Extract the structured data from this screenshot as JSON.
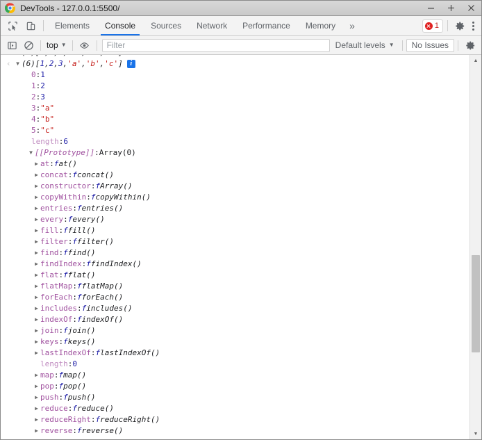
{
  "window": {
    "title": "DevTools - 127.0.0.1:5500/",
    "logo_icon": "chrome-logo",
    "controls": {
      "minimize": "−",
      "maximize": "+",
      "close": "×"
    }
  },
  "tabbar": {
    "inspect_icon": "inspect-element-icon",
    "device_icon": "device-toolbar-icon",
    "tabs": [
      {
        "label": "Elements",
        "active": false
      },
      {
        "label": "Console",
        "active": true
      },
      {
        "label": "Sources",
        "active": false
      },
      {
        "label": "Network",
        "active": false
      },
      {
        "label": "Performance",
        "active": false
      },
      {
        "label": "Memory",
        "active": false
      }
    ],
    "more_tabs": "»",
    "error_count": "1",
    "error_icon": "error-circle-icon",
    "settings_icon": "gear-icon",
    "menu_icon": "kebab-menu-icon"
  },
  "console_toolbar": {
    "sidebar_icon": "console-sidebar-icon",
    "clear_icon": "clear-console-icon",
    "context": "top",
    "context_caret": "▼",
    "eye_icon": "live-expression-icon",
    "filter_placeholder": "Filter",
    "filter_value": "",
    "levels_label": "Default levels",
    "levels_caret": "▼",
    "issues_label": "No Issues",
    "settings_icon": "gear-icon"
  },
  "console": {
    "clipped_row_note": "partially-scrolled array preview",
    "header": {
      "input_arrow": "‹",
      "triangle": "▼",
      "count": "(6)",
      "open": "[",
      "items": [
        {
          "text": "1",
          "type": "num"
        },
        {
          "text": "2",
          "type": "num"
        },
        {
          "text": "3",
          "type": "num"
        },
        {
          "text": "'a'",
          "type": "str"
        },
        {
          "text": "'b'",
          "type": "str"
        },
        {
          "text": "'c'",
          "type": "str"
        }
      ],
      "close": "]",
      "info_badge": "i"
    },
    "indexed_properties": [
      {
        "key": "0",
        "value": "1",
        "type": "num"
      },
      {
        "key": "1",
        "value": "2",
        "type": "num"
      },
      {
        "key": "2",
        "value": "3",
        "type": "num"
      },
      {
        "key": "3",
        "value": "\"a\"",
        "type": "str"
      },
      {
        "key": "4",
        "value": "\"b\"",
        "type": "str"
      },
      {
        "key": "5",
        "value": "\"c\"",
        "type": "str"
      }
    ],
    "length_row": {
      "key": "length",
      "value": "6"
    },
    "prototype_row": {
      "triangle": "▼",
      "key": "[[Prototype]]",
      "value": "Array(0)"
    },
    "prototype_members": [
      {
        "key": "at",
        "fn": "at()",
        "expandable": true
      },
      {
        "key": "concat",
        "fn": "concat()",
        "expandable": true
      },
      {
        "key": "constructor",
        "fn": "Array()",
        "expandable": true
      },
      {
        "key": "copyWithin",
        "fn": "copyWithin()",
        "expandable": true
      },
      {
        "key": "entries",
        "fn": "entries()",
        "expandable": true
      },
      {
        "key": "every",
        "fn": "every()",
        "expandable": true
      },
      {
        "key": "fill",
        "fn": "fill()",
        "expandable": true
      },
      {
        "key": "filter",
        "fn": "filter()",
        "expandable": true
      },
      {
        "key": "find",
        "fn": "find()",
        "expandable": true
      },
      {
        "key": "findIndex",
        "fn": "findIndex()",
        "expandable": true
      },
      {
        "key": "flat",
        "fn": "flat()",
        "expandable": true
      },
      {
        "key": "flatMap",
        "fn": "flatMap()",
        "expandable": true
      },
      {
        "key": "forEach",
        "fn": "forEach()",
        "expandable": true
      },
      {
        "key": "includes",
        "fn": "includes()",
        "expandable": true
      },
      {
        "key": "indexOf",
        "fn": "indexOf()",
        "expandable": true
      },
      {
        "key": "join",
        "fn": "join()",
        "expandable": true
      },
      {
        "key": "keys",
        "fn": "keys()",
        "expandable": true
      },
      {
        "key": "lastIndexOf",
        "fn": "lastIndexOf()",
        "expandable": true
      },
      {
        "key": "length",
        "value": "0",
        "expandable": false
      },
      {
        "key": "map",
        "fn": "map()",
        "expandable": true
      },
      {
        "key": "pop",
        "fn": "pop()",
        "expandable": true
      },
      {
        "key": "push",
        "fn": "push()",
        "expandable": true
      },
      {
        "key": "reduce",
        "fn": "reduce()",
        "expandable": true
      },
      {
        "key": "reduceRight",
        "fn": "reduceRight()",
        "expandable": true
      },
      {
        "key": "reverse",
        "fn": "reverse()",
        "expandable": true
      }
    ],
    "fn_marker": "f",
    "collapsed_triangle": "▶"
  },
  "scrollbar": {
    "up_arrow": "▲",
    "down_arrow": "▼"
  }
}
